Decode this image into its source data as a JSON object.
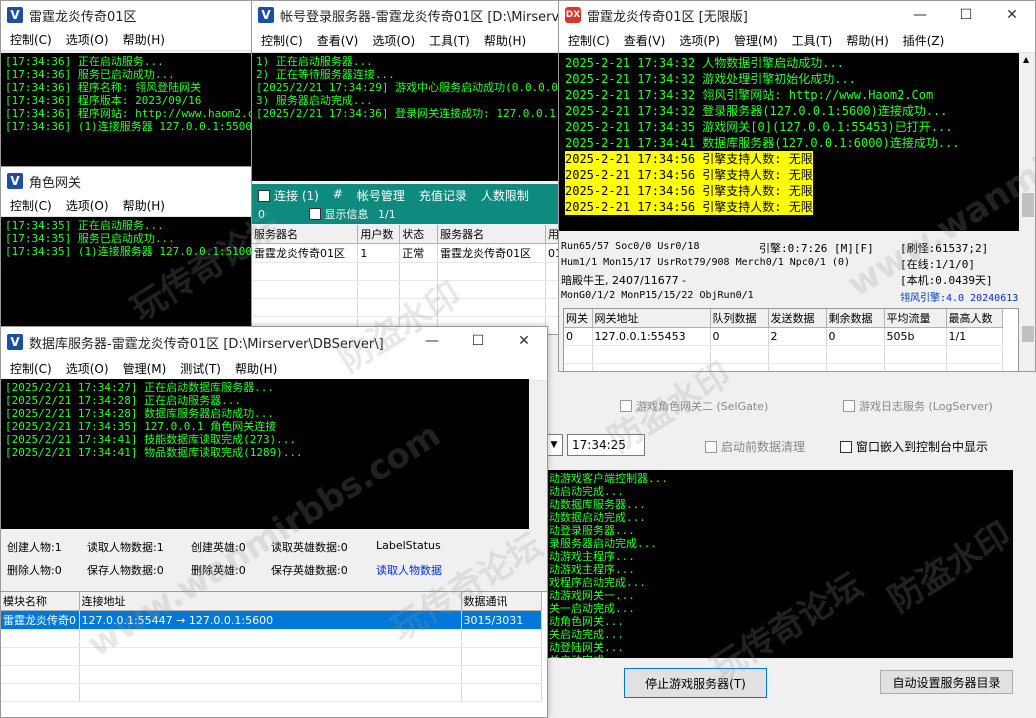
{
  "win_main": {
    "title": "雷霆龙炎传奇01区",
    "menu": [
      "控制(C)",
      "选项(O)",
      "帮助(H)"
    ],
    "lines": [
      "[17:34:36] 正在启动服务...",
      "[17:34:36] 服务已启动成功...",
      "[17:34:36] 程序名称: 翎风登陆网关",
      "[17:34:36] 程序版本: 2023/09/16",
      "[17:34:36] 程序网站: http://www.haom2.com",
      "[17:34:36] (1)连接服务器 127.0.0.1:5500 成"
    ]
  },
  "win_role": {
    "title": "角色网关",
    "menu": [
      "控制(C)",
      "选项(O)",
      "帮助(H)"
    ],
    "lines": [
      "[17:34:35] 正在启动服务...",
      "[17:34:35] 服务已启动成功...",
      "[17:34:35] (1)连接服务器 127.0.0.1:5100 成"
    ]
  },
  "win_login": {
    "title": "帐号登录服务器-雷霆龙炎传奇01区 [D:\\Mirserver\\",
    "menu": [
      "控制(C)",
      "查看(V)",
      "选项(O)",
      "工具(T)",
      "帮助(H)"
    ],
    "lines": [
      "1) 正在启动服务器...",
      "2) 正在等待服务器连接...",
      "[2025/2/21 17:34:29] 游戏中心服务启动成功(0.0.0.0:5",
      "3) 服务器启动完成...",
      "[2025/2/21 17:34:36] 登录网关连接成功: 127.0.0.1"
    ],
    "tabs": [
      "连接 (1)",
      "#",
      "帐号管理",
      "充值记录",
      "人数限制"
    ],
    "count_zero": "0",
    "show_info": "显示信息",
    "page": "1/1",
    "headers": [
      "服务器名",
      "用户数",
      "状态",
      "服务器名",
      "用"
    ],
    "rows": [
      [
        "雷霆龙炎传奇01区",
        "1",
        "正常",
        "雷霆龙炎传奇01区",
        "01"
      ]
    ]
  },
  "win_engine": {
    "title": "雷霆龙炎传奇01区 [无限版]",
    "menu": [
      "控制(C)",
      "查看(V)",
      "选项(P)",
      "管理(M)",
      "工具(T)",
      "帮助(H)",
      "插件(Z)"
    ],
    "lines": [
      "2025-2-21 17:34:32 人物数据引擎启动成功...",
      "2025-2-21 17:34:32 游戏处理引擎初始化成功...",
      "2025-2-21 17:34:32 翎风引擎网站: http://www.Haom2.Com",
      "2025-2-21 17:34:32 登录服务器(127.0.0.1:5600)连接成功...",
      "2025-2-21 17:34:35 游戏网关[0](127.0.0.1:55453)已打开...",
      "2025-2-21 17:34:41 数据库服务器(127.0.0.1:6000)连接成功..."
    ],
    "hl_lines": [
      "2025-2-21 17:34:56 引擎支持人数: 无限",
      "2025-2-21 17:34:56 引擎支持人数: 无限",
      "2025-2-21 17:34:56 引擎支持人数: 无限",
      "2025-2-21 17:34:56 引擎支持人数: 无限"
    ],
    "stat1": "Run65/57 Soc0/0 Usr0/18",
    "stat2": "Hum1/1 Mon15/17 UsrRot79/908 Merch0/1 Npc0/1 (0)",
    "stat3": "暗殿牛王, 2407/11677 -",
    "stat4": "MonG0/1/2 MonP15/15/22 ObjRun0/1",
    "engine_time": "引擎:0:7:26 [M][F]",
    "refresh": "[刷怪:61537;2]",
    "online": "[在线:1/1/0]",
    "local": "[本机:0.0439天]",
    "version": "翎风引擎:4.0 20240613",
    "headers": [
      "网关",
      "网关地址",
      "队列数据",
      "发送数据",
      "剩余数据",
      "平均流量",
      "最高人数"
    ],
    "rows": [
      [
        "0",
        "127.0.0.1:55453",
        "0",
        "2",
        "0",
        "505b",
        "1/1"
      ]
    ]
  },
  "win_db": {
    "title": "数据库服务器-雷霆龙炎传奇01区 [D:\\Mirserver\\DBServer\\]",
    "menu": [
      "控制(C)",
      "选项(O)",
      "管理(M)",
      "测试(T)",
      "帮助(H)"
    ],
    "lines": [
      "[2025/2/21 17:34:27] 正在启动数据库服务器...",
      "[2025/2/21 17:34:28] 正在启动服务器...",
      "[2025/2/21 17:34:28] 数据库服务器启动成功...",
      "[2025/2/21 17:34:35] 127.0.0.1 角色网关连接",
      "[2025/2/21 17:34:41] 技能数据库读取完成(273)...",
      "[2025/2/21 17:34:41] 物品数据库读取完成(1289)..."
    ],
    "stats_row1": [
      "创建人物:1",
      "读取人物数据:1",
      "创建英雄:0",
      "读取英雄数据:0",
      "LabelStatus"
    ],
    "stats_row2": [
      "删除人物:0",
      "保存人物数据:0",
      "删除英雄:0",
      "保存英雄数据:0",
      "读取人物数据"
    ],
    "headers": [
      "模块名称",
      "连接地址",
      "数据通讯"
    ],
    "rows": [
      [
        "雷霆龙炎传奇0",
        "127.0.0.1:55447 → 127.0.0.1:5600",
        "3015/3031"
      ]
    ]
  },
  "ctrl_panel": {
    "sel_gate": "游戏角色网关二 (SelGate)",
    "log_server": "游戏日志服务 (LogServer)",
    "time": "17:34:25",
    "startup_clean": "启动前数据清理",
    "embed": "窗口嵌入到控制台中显示",
    "lines": [
      "动游戏客户端控制器...",
      "动启动完成...",
      "动数据库服务器...",
      "动数据启动完成...",
      "动登录服务器...",
      "录服务器启动完成...",
      "动游戏主程序...",
      "动游戏主程序...",
      "戏程序启动完成...",
      "动游戏网关一...",
      "关一启动完成...",
      "动角色网关...",
      "关启动完成...",
      "动登陆网关...",
      "关启动完成..."
    ],
    "stop_btn": "停止游戏服务器(T)",
    "auto_btn": "自动设置服务器目录"
  },
  "watermarks": [
    "玩传奇论坛",
    "防盗水印",
    "www.wanmirbbs.com",
    "玩传奇论坛",
    "防盗水印",
    "www.wanmirbbs.com",
    "玩传奇论坛",
    "防盗水印"
  ],
  "colors": {
    "console_bg": "#000000",
    "console_fg": "#29ff29",
    "highlight": "#ffff00",
    "selection": "#0078d7",
    "link": "#0033cc"
  }
}
